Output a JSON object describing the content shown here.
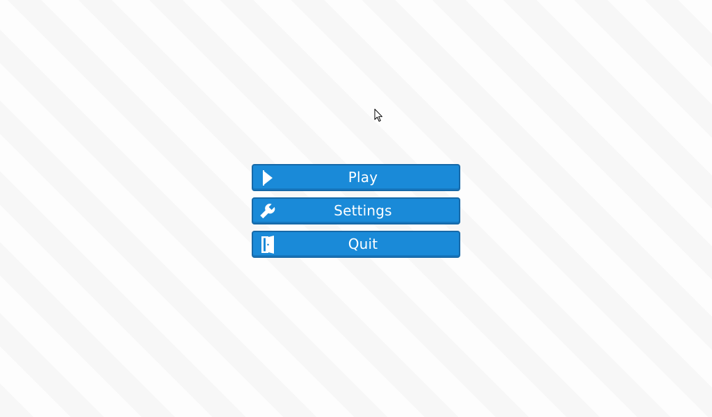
{
  "menu": {
    "items": [
      {
        "label": "Play",
        "icon": "play-icon"
      },
      {
        "label": "Settings",
        "icon": "wrench-icon"
      },
      {
        "label": "Quit",
        "icon": "door-exit-icon"
      }
    ]
  },
  "colors": {
    "button_fill": "#1a8ad8",
    "button_border": "#1669a8",
    "button_text": "#ffffff",
    "background_light": "#fdfdfd",
    "background_stripe": "#f7f7f7"
  },
  "cursor": {
    "icon": "arrow-cursor-icon"
  }
}
